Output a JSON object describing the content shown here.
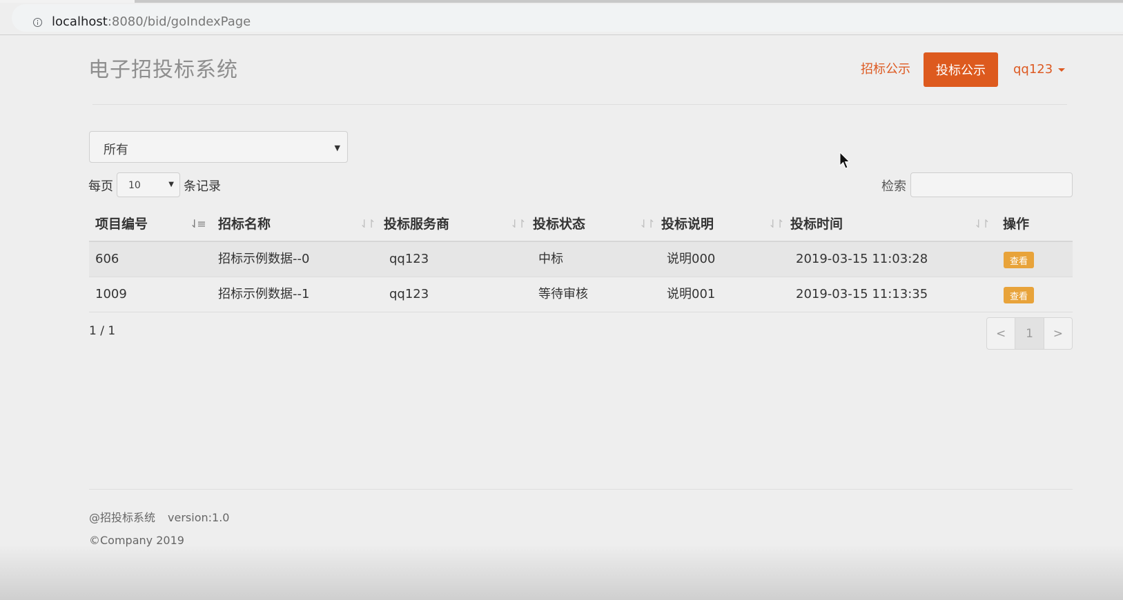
{
  "browser": {
    "url_host": "localhost",
    "url_rest": ":8080/bid/goIndexPage"
  },
  "header": {
    "brand": "电子招投标系统",
    "nav": [
      {
        "label": "招标公示",
        "active": false
      },
      {
        "label": "投标公示",
        "active": true
      }
    ],
    "user": "qq123"
  },
  "filter": {
    "selected": "所有"
  },
  "length": {
    "prefix": "每页",
    "value": "10",
    "suffix": "条记录"
  },
  "search": {
    "label": "检索",
    "value": ""
  },
  "table": {
    "columns": [
      "项目编号",
      "招标名称",
      "投标服务商",
      "投标状态",
      "投标说明",
      "投标时间",
      "操作"
    ],
    "rows": [
      [
        "606",
        "招标示例数据--0",
        "qq123",
        "中标",
        "说明000",
        "2019-03-15 11:03:28",
        "查看"
      ],
      [
        "1009",
        "招标示例数据--1",
        "qq123",
        "等待审核",
        "说明001",
        "2019-03-15 11:13:35",
        "查看"
      ]
    ]
  },
  "pagination": {
    "info": "1 / 1",
    "prev": "<",
    "current": "1",
    "next": ">"
  },
  "footer": {
    "system": "@招投标系统",
    "version": "version:1.0",
    "copyright": "©Company 2019"
  },
  "colors": {
    "accent": "#dd5a1e",
    "view_button": "#e8a33a",
    "background": "#eeeeee"
  }
}
